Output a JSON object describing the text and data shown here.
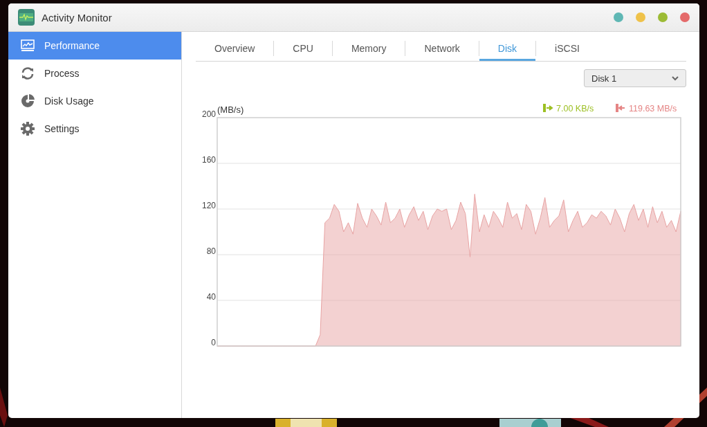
{
  "window": {
    "title": "Activity Monitor"
  },
  "sidebar": {
    "items": [
      {
        "label": "Performance",
        "kind": "performance",
        "selected": true
      },
      {
        "label": "Process",
        "kind": "process",
        "selected": false
      },
      {
        "label": "Disk Usage",
        "kind": "disk-usage",
        "selected": false
      },
      {
        "label": "Settings",
        "kind": "settings",
        "selected": false
      }
    ]
  },
  "tabs": [
    {
      "label": "Overview",
      "selected": false
    },
    {
      "label": "CPU",
      "selected": false
    },
    {
      "label": "Memory",
      "selected": false
    },
    {
      "label": "Network",
      "selected": false
    },
    {
      "label": "Disk",
      "selected": true
    },
    {
      "label": "iSCSI",
      "selected": false
    }
  ],
  "disk_select": {
    "value": "Disk 1"
  },
  "chart": {
    "legend": [
      {
        "kind": "read",
        "reading": "7.00 KB/s",
        "color": "#9cbf22"
      },
      {
        "kind": "write",
        "reading": "119.63 MB/s",
        "color": "#e58585"
      }
    ],
    "chart_data": {
      "type": "area",
      "grid": true,
      "ylabel": "(MB/s)",
      "ylim": [
        0,
        200
      ],
      "yticks": [
        0,
        40,
        80,
        120,
        160,
        200
      ],
      "series": [
        {
          "color": "#e8a3a3",
          "values": [
            0,
            0,
            0,
            0,
            0,
            0,
            0,
            0,
            0,
            0,
            0,
            0,
            0,
            0,
            0,
            0,
            0,
            0,
            0,
            0,
            0,
            0,
            10,
            108,
            112,
            124,
            118,
            100,
            108,
            98,
            125,
            112,
            104,
            120,
            114,
            106,
            126,
            108,
            112,
            120,
            104,
            115,
            122,
            110,
            118,
            102,
            114,
            120,
            118,
            120,
            102,
            110,
            126,
            116,
            78,
            133,
            100,
            115,
            104,
            118,
            112,
            104,
            126,
            112,
            116,
            102,
            124,
            118,
            98,
            112,
            130,
            104,
            110,
            114,
            128,
            100,
            110,
            118,
            104,
            108,
            115,
            112,
            118,
            114,
            106,
            120,
            112,
            100,
            116,
            124,
            110,
            120,
            104,
            122,
            108,
            118,
            104,
            110,
            100,
            118
          ]
        }
      ]
    }
  }
}
